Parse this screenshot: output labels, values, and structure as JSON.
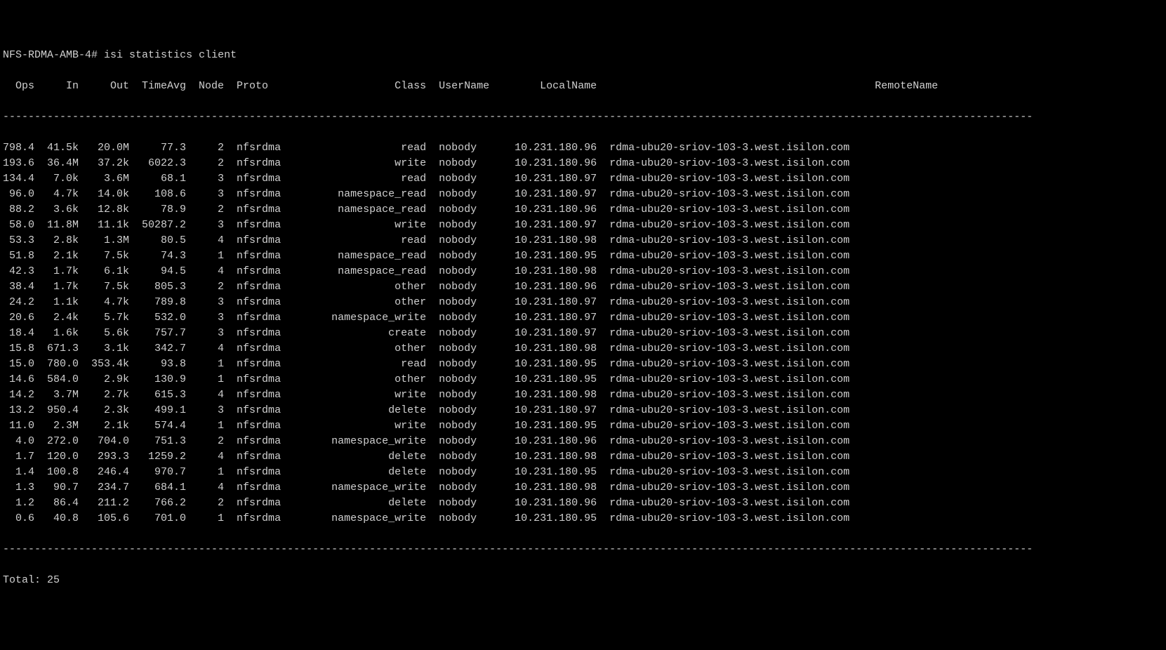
{
  "prompt": {
    "host": "NFS-RDMA-AMB-4#",
    "command": "isi statistics client"
  },
  "headers": {
    "ops": "Ops",
    "in": "In",
    "out": "Out",
    "timeavg": "TimeAvg",
    "node": "Node",
    "proto": "Proto",
    "class": "Class",
    "username": "UserName",
    "localname": "LocalName",
    "remotename": "RemoteName"
  },
  "dashes": "-------------------------------------------------------------------------------------------------------------------------------------------------------------------",
  "rows": [
    {
      "ops": "798.4",
      "in": "41.5k",
      "out": "20.0M",
      "timeavg": "77.3",
      "node": "2",
      "proto": "nfsrdma",
      "class": "read",
      "username": "nobody",
      "localname": "10.231.180.96",
      "remotename": "rdma-ubu20-sriov-103-3.west.isilon.com"
    },
    {
      "ops": "193.6",
      "in": "36.4M",
      "out": "37.2k",
      "timeavg": "6022.3",
      "node": "2",
      "proto": "nfsrdma",
      "class": "write",
      "username": "nobody",
      "localname": "10.231.180.96",
      "remotename": "rdma-ubu20-sriov-103-3.west.isilon.com"
    },
    {
      "ops": "134.4",
      "in": "7.0k",
      "out": "3.6M",
      "timeavg": "68.1",
      "node": "3",
      "proto": "nfsrdma",
      "class": "read",
      "username": "nobody",
      "localname": "10.231.180.97",
      "remotename": "rdma-ubu20-sriov-103-3.west.isilon.com"
    },
    {
      "ops": "96.0",
      "in": "4.7k",
      "out": "14.0k",
      "timeavg": "108.6",
      "node": "3",
      "proto": "nfsrdma",
      "class": "namespace_read",
      "username": "nobody",
      "localname": "10.231.180.97",
      "remotename": "rdma-ubu20-sriov-103-3.west.isilon.com"
    },
    {
      "ops": "88.2",
      "in": "3.6k",
      "out": "12.8k",
      "timeavg": "78.9",
      "node": "2",
      "proto": "nfsrdma",
      "class": "namespace_read",
      "username": "nobody",
      "localname": "10.231.180.96",
      "remotename": "rdma-ubu20-sriov-103-3.west.isilon.com"
    },
    {
      "ops": "58.0",
      "in": "11.8M",
      "out": "11.1k",
      "timeavg": "50287.2",
      "node": "3",
      "proto": "nfsrdma",
      "class": "write",
      "username": "nobody",
      "localname": "10.231.180.97",
      "remotename": "rdma-ubu20-sriov-103-3.west.isilon.com"
    },
    {
      "ops": "53.3",
      "in": "2.8k",
      "out": "1.3M",
      "timeavg": "80.5",
      "node": "4",
      "proto": "nfsrdma",
      "class": "read",
      "username": "nobody",
      "localname": "10.231.180.98",
      "remotename": "rdma-ubu20-sriov-103-3.west.isilon.com"
    },
    {
      "ops": "51.8",
      "in": "2.1k",
      "out": "7.5k",
      "timeavg": "74.3",
      "node": "1",
      "proto": "nfsrdma",
      "class": "namespace_read",
      "username": "nobody",
      "localname": "10.231.180.95",
      "remotename": "rdma-ubu20-sriov-103-3.west.isilon.com"
    },
    {
      "ops": "42.3",
      "in": "1.7k",
      "out": "6.1k",
      "timeavg": "94.5",
      "node": "4",
      "proto": "nfsrdma",
      "class": "namespace_read",
      "username": "nobody",
      "localname": "10.231.180.98",
      "remotename": "rdma-ubu20-sriov-103-3.west.isilon.com"
    },
    {
      "ops": "38.4",
      "in": "1.7k",
      "out": "7.5k",
      "timeavg": "805.3",
      "node": "2",
      "proto": "nfsrdma",
      "class": "other",
      "username": "nobody",
      "localname": "10.231.180.96",
      "remotename": "rdma-ubu20-sriov-103-3.west.isilon.com"
    },
    {
      "ops": "24.2",
      "in": "1.1k",
      "out": "4.7k",
      "timeavg": "789.8",
      "node": "3",
      "proto": "nfsrdma",
      "class": "other",
      "username": "nobody",
      "localname": "10.231.180.97",
      "remotename": "rdma-ubu20-sriov-103-3.west.isilon.com"
    },
    {
      "ops": "20.6",
      "in": "2.4k",
      "out": "5.7k",
      "timeavg": "532.0",
      "node": "3",
      "proto": "nfsrdma",
      "class": "namespace_write",
      "username": "nobody",
      "localname": "10.231.180.97",
      "remotename": "rdma-ubu20-sriov-103-3.west.isilon.com"
    },
    {
      "ops": "18.4",
      "in": "1.6k",
      "out": "5.6k",
      "timeavg": "757.7",
      "node": "3",
      "proto": "nfsrdma",
      "class": "create",
      "username": "nobody",
      "localname": "10.231.180.97",
      "remotename": "rdma-ubu20-sriov-103-3.west.isilon.com"
    },
    {
      "ops": "15.8",
      "in": "671.3",
      "out": "3.1k",
      "timeavg": "342.7",
      "node": "4",
      "proto": "nfsrdma",
      "class": "other",
      "username": "nobody",
      "localname": "10.231.180.98",
      "remotename": "rdma-ubu20-sriov-103-3.west.isilon.com"
    },
    {
      "ops": "15.0",
      "in": "780.0",
      "out": "353.4k",
      "timeavg": "93.8",
      "node": "1",
      "proto": "nfsrdma",
      "class": "read",
      "username": "nobody",
      "localname": "10.231.180.95",
      "remotename": "rdma-ubu20-sriov-103-3.west.isilon.com"
    },
    {
      "ops": "14.6",
      "in": "584.0",
      "out": "2.9k",
      "timeavg": "130.9",
      "node": "1",
      "proto": "nfsrdma",
      "class": "other",
      "username": "nobody",
      "localname": "10.231.180.95",
      "remotename": "rdma-ubu20-sriov-103-3.west.isilon.com"
    },
    {
      "ops": "14.2",
      "in": "3.7M",
      "out": "2.7k",
      "timeavg": "615.3",
      "node": "4",
      "proto": "nfsrdma",
      "class": "write",
      "username": "nobody",
      "localname": "10.231.180.98",
      "remotename": "rdma-ubu20-sriov-103-3.west.isilon.com"
    },
    {
      "ops": "13.2",
      "in": "950.4",
      "out": "2.3k",
      "timeavg": "499.1",
      "node": "3",
      "proto": "nfsrdma",
      "class": "delete",
      "username": "nobody",
      "localname": "10.231.180.97",
      "remotename": "rdma-ubu20-sriov-103-3.west.isilon.com"
    },
    {
      "ops": "11.0",
      "in": "2.3M",
      "out": "2.1k",
      "timeavg": "574.4",
      "node": "1",
      "proto": "nfsrdma",
      "class": "write",
      "username": "nobody",
      "localname": "10.231.180.95",
      "remotename": "rdma-ubu20-sriov-103-3.west.isilon.com"
    },
    {
      "ops": "4.0",
      "in": "272.0",
      "out": "704.0",
      "timeavg": "751.3",
      "node": "2",
      "proto": "nfsrdma",
      "class": "namespace_write",
      "username": "nobody",
      "localname": "10.231.180.96",
      "remotename": "rdma-ubu20-sriov-103-3.west.isilon.com"
    },
    {
      "ops": "1.7",
      "in": "120.0",
      "out": "293.3",
      "timeavg": "1259.2",
      "node": "4",
      "proto": "nfsrdma",
      "class": "delete",
      "username": "nobody",
      "localname": "10.231.180.98",
      "remotename": "rdma-ubu20-sriov-103-3.west.isilon.com"
    },
    {
      "ops": "1.4",
      "in": "100.8",
      "out": "246.4",
      "timeavg": "970.7",
      "node": "1",
      "proto": "nfsrdma",
      "class": "delete",
      "username": "nobody",
      "localname": "10.231.180.95",
      "remotename": "rdma-ubu20-sriov-103-3.west.isilon.com"
    },
    {
      "ops": "1.3",
      "in": "90.7",
      "out": "234.7",
      "timeavg": "684.1",
      "node": "4",
      "proto": "nfsrdma",
      "class": "namespace_write",
      "username": "nobody",
      "localname": "10.231.180.98",
      "remotename": "rdma-ubu20-sriov-103-3.west.isilon.com"
    },
    {
      "ops": "1.2",
      "in": "86.4",
      "out": "211.2",
      "timeavg": "766.2",
      "node": "2",
      "proto": "nfsrdma",
      "class": "delete",
      "username": "nobody",
      "localname": "10.231.180.96",
      "remotename": "rdma-ubu20-sriov-103-3.west.isilon.com"
    },
    {
      "ops": "0.6",
      "in": "40.8",
      "out": "105.6",
      "timeavg": "701.0",
      "node": "1",
      "proto": "nfsrdma",
      "class": "namespace_write",
      "username": "nobody",
      "localname": "10.231.180.95",
      "remotename": "rdma-ubu20-sriov-103-3.west.isilon.com"
    }
  ],
  "total": {
    "label": "Total:",
    "count": "25"
  }
}
